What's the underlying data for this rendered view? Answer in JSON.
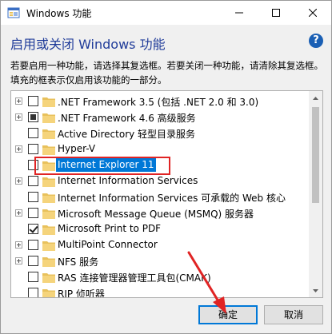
{
  "window": {
    "title": "Windows 功能",
    "heading": "启用或关闭 Windows 功能",
    "help_symbol": "?",
    "description": "若要启用一种功能，请选择其复选框。若要关闭一种功能，请清除其复选框。填充的框表示仅启用该功能的一部分。"
  },
  "features": [
    {
      "label": ".NET Framework 3.5 (包括 .NET 2.0 和 3.0)",
      "state": "unchecked",
      "expandable": true,
      "selected": false
    },
    {
      "label": ".NET Framework 4.6 高级服务",
      "state": "partial",
      "expandable": true,
      "selected": false
    },
    {
      "label": "Active Directory 轻型目录服务",
      "state": "unchecked",
      "expandable": false,
      "selected": false
    },
    {
      "label": "Hyper-V",
      "state": "unchecked",
      "expandable": true,
      "selected": false
    },
    {
      "label": "Internet Explorer 11",
      "state": "unchecked",
      "expandable": false,
      "selected": true
    },
    {
      "label": "Internet Information Services",
      "state": "unchecked",
      "expandable": true,
      "selected": false
    },
    {
      "label": "Internet Information Services 可承载的 Web 核心",
      "state": "unchecked",
      "expandable": false,
      "selected": false
    },
    {
      "label": "Microsoft Message Queue (MSMQ) 服务器",
      "state": "unchecked",
      "expandable": true,
      "selected": false
    },
    {
      "label": "Microsoft Print to PDF",
      "state": "checked",
      "expandable": false,
      "selected": false
    },
    {
      "label": "MultiPoint Connector",
      "state": "unchecked",
      "expandable": true,
      "selected": false
    },
    {
      "label": "NFS 服务",
      "state": "unchecked",
      "expandable": true,
      "selected": false
    },
    {
      "label": "RAS 连接管理器管理工具包(CMAK)",
      "state": "unchecked",
      "expandable": false,
      "selected": false
    },
    {
      "label": "RIP 侦听器",
      "state": "unchecked",
      "expandable": false,
      "selected": false
    }
  ],
  "buttons": {
    "ok": "确定",
    "cancel": "取消"
  },
  "colors": {
    "heading": "#1f3b99",
    "selection": "#0078d7",
    "annotation_red": "#e02424",
    "folder": "#e8c15c"
  },
  "icons": [
    "windows-features-icon",
    "minimize-icon",
    "maximize-icon",
    "close-icon",
    "help-icon",
    "expand-plus-icon",
    "folder-icon",
    "scroll-up-icon",
    "scroll-down-icon",
    "annotation-arrow"
  ]
}
